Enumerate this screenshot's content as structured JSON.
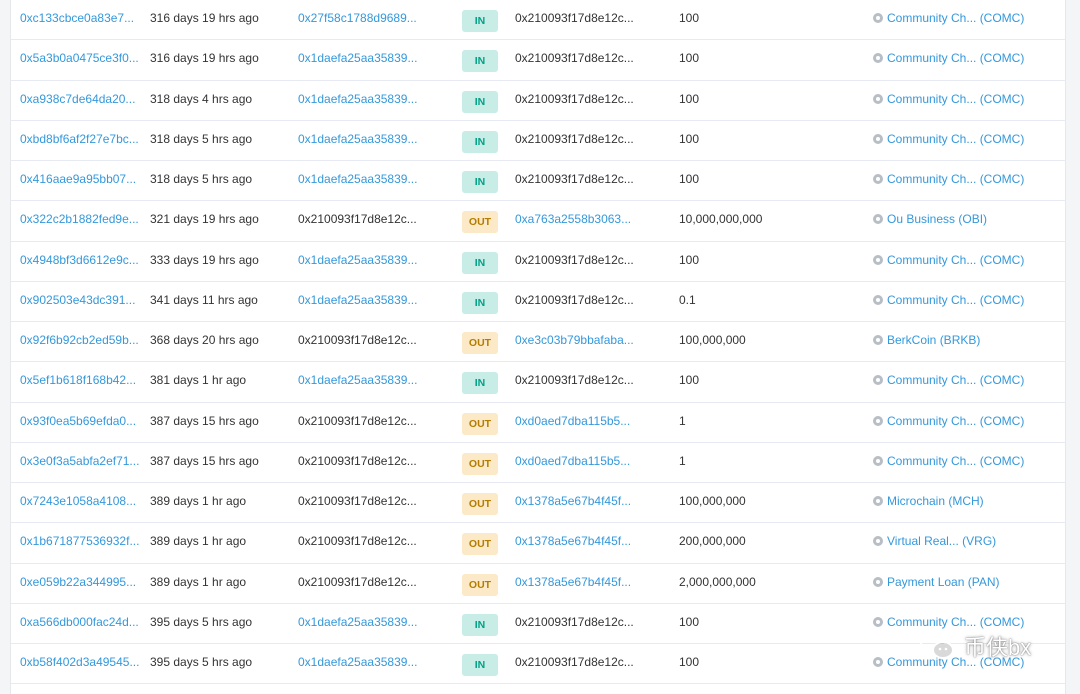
{
  "colors": {
    "link": "#3498db",
    "in_badge_bg": "#c8ece6",
    "in_badge_text": "#00a186",
    "out_badge_bg": "#fbe9c7",
    "out_badge_text": "#b47d00"
  },
  "rows": [
    {
      "hash": "0xc133cbce0a83e7...",
      "age": "316 days 19 hrs ago",
      "from": "0x27f58c1788d9689...",
      "from_link": true,
      "dir": "IN",
      "to": "0x210093f17d8e12c...",
      "to_link": false,
      "quantity": "100",
      "token": "Community Ch... (COMC)"
    },
    {
      "hash": "0x5a3b0a0475ce3f0...",
      "age": "316 days 19 hrs ago",
      "from": "0x1daefa25aa35839...",
      "from_link": true,
      "dir": "IN",
      "to": "0x210093f17d8e12c...",
      "to_link": false,
      "quantity": "100",
      "token": "Community Ch... (COMC)"
    },
    {
      "hash": "0xa938c7de64da20...",
      "age": "318 days 4 hrs ago",
      "from": "0x1daefa25aa35839...",
      "from_link": true,
      "dir": "IN",
      "to": "0x210093f17d8e12c...",
      "to_link": false,
      "quantity": "100",
      "token": "Community Ch... (COMC)"
    },
    {
      "hash": "0xbd8bf6af2f27e7bc...",
      "age": "318 days 5 hrs ago",
      "from": "0x1daefa25aa35839...",
      "from_link": true,
      "dir": "IN",
      "to": "0x210093f17d8e12c...",
      "to_link": false,
      "quantity": "100",
      "token": "Community Ch... (COMC)"
    },
    {
      "hash": "0x416aae9a95bb07...",
      "age": "318 days 5 hrs ago",
      "from": "0x1daefa25aa35839...",
      "from_link": true,
      "dir": "IN",
      "to": "0x210093f17d8e12c...",
      "to_link": false,
      "quantity": "100",
      "token": "Community Ch... (COMC)"
    },
    {
      "hash": "0x322c2b1882fed9e...",
      "age": "321 days 19 hrs ago",
      "from": "0x210093f17d8e12c...",
      "from_link": false,
      "dir": "OUT",
      "to": "0xa763a2558b3063...",
      "to_link": true,
      "quantity": "10,000,000,000",
      "token": "Ou Business (OBI)"
    },
    {
      "hash": "0x4948bf3d6612e9c...",
      "age": "333 days 19 hrs ago",
      "from": "0x1daefa25aa35839...",
      "from_link": true,
      "dir": "IN",
      "to": "0x210093f17d8e12c...",
      "to_link": false,
      "quantity": "100",
      "token": "Community Ch... (COMC)"
    },
    {
      "hash": "0x902503e43dc391...",
      "age": "341 days 11 hrs ago",
      "from": "0x1daefa25aa35839...",
      "from_link": true,
      "dir": "IN",
      "to": "0x210093f17d8e12c...",
      "to_link": false,
      "quantity": "0.1",
      "token": "Community Ch... (COMC)"
    },
    {
      "hash": "0x92f6b92cb2ed59b...",
      "age": "368 days 20 hrs ago",
      "from": "0x210093f17d8e12c...",
      "from_link": false,
      "dir": "OUT",
      "to": "0xe3c03b79bbafaba...",
      "to_link": true,
      "quantity": "100,000,000",
      "token": "BerkCoin (BRKB)"
    },
    {
      "hash": "0x5ef1b618f168b42...",
      "age": "381 days 1 hr ago",
      "from": "0x1daefa25aa35839...",
      "from_link": true,
      "dir": "IN",
      "to": "0x210093f17d8e12c...",
      "to_link": false,
      "quantity": "100",
      "token": "Community Ch... (COMC)"
    },
    {
      "hash": "0x93f0ea5b69efda0...",
      "age": "387 days 15 hrs ago",
      "from": "0x210093f17d8e12c...",
      "from_link": false,
      "dir": "OUT",
      "to": "0xd0aed7dba115b5...",
      "to_link": true,
      "quantity": "1",
      "token": "Community Ch... (COMC)"
    },
    {
      "hash": "0x3e0f3a5abfa2ef71...",
      "age": "387 days 15 hrs ago",
      "from": "0x210093f17d8e12c...",
      "from_link": false,
      "dir": "OUT",
      "to": "0xd0aed7dba115b5...",
      "to_link": true,
      "quantity": "1",
      "token": "Community Ch... (COMC)"
    },
    {
      "hash": "0x7243e1058a4108...",
      "age": "389 days 1 hr ago",
      "from": "0x210093f17d8e12c...",
      "from_link": false,
      "dir": "OUT",
      "to": "0x1378a5e67b4f45f...",
      "to_link": true,
      "quantity": "100,000,000",
      "token": "Microchain (MCH)"
    },
    {
      "hash": "0x1b671877536932f...",
      "age": "389 days 1 hr ago",
      "from": "0x210093f17d8e12c...",
      "from_link": false,
      "dir": "OUT",
      "to": "0x1378a5e67b4f45f...",
      "to_link": true,
      "quantity": "200,000,000",
      "token": "Virtual Real... (VRG)"
    },
    {
      "hash": "0xe059b22a344995...",
      "age": "389 days 1 hr ago",
      "from": "0x210093f17d8e12c...",
      "from_link": false,
      "dir": "OUT",
      "to": "0x1378a5e67b4f45f...",
      "to_link": true,
      "quantity": "2,000,000,000",
      "token": "Payment Loan (PAN)"
    },
    {
      "hash": "0xa566db000fac24d...",
      "age": "395 days 5 hrs ago",
      "from": "0x1daefa25aa35839...",
      "from_link": true,
      "dir": "IN",
      "to": "0x210093f17d8e12c...",
      "to_link": false,
      "quantity": "100",
      "token": "Community Ch... (COMC)"
    },
    {
      "hash": "0xb58f402d3a49545...",
      "age": "395 days 5 hrs ago",
      "from": "0x1daefa25aa35839...",
      "from_link": true,
      "dir": "IN",
      "to": "0x210093f17d8e12c...",
      "to_link": false,
      "quantity": "100",
      "token": "Community Ch... (COMC)"
    }
  ],
  "watermark": {
    "text": "币侠bx",
    "icon": "wechat-logo-icon"
  }
}
